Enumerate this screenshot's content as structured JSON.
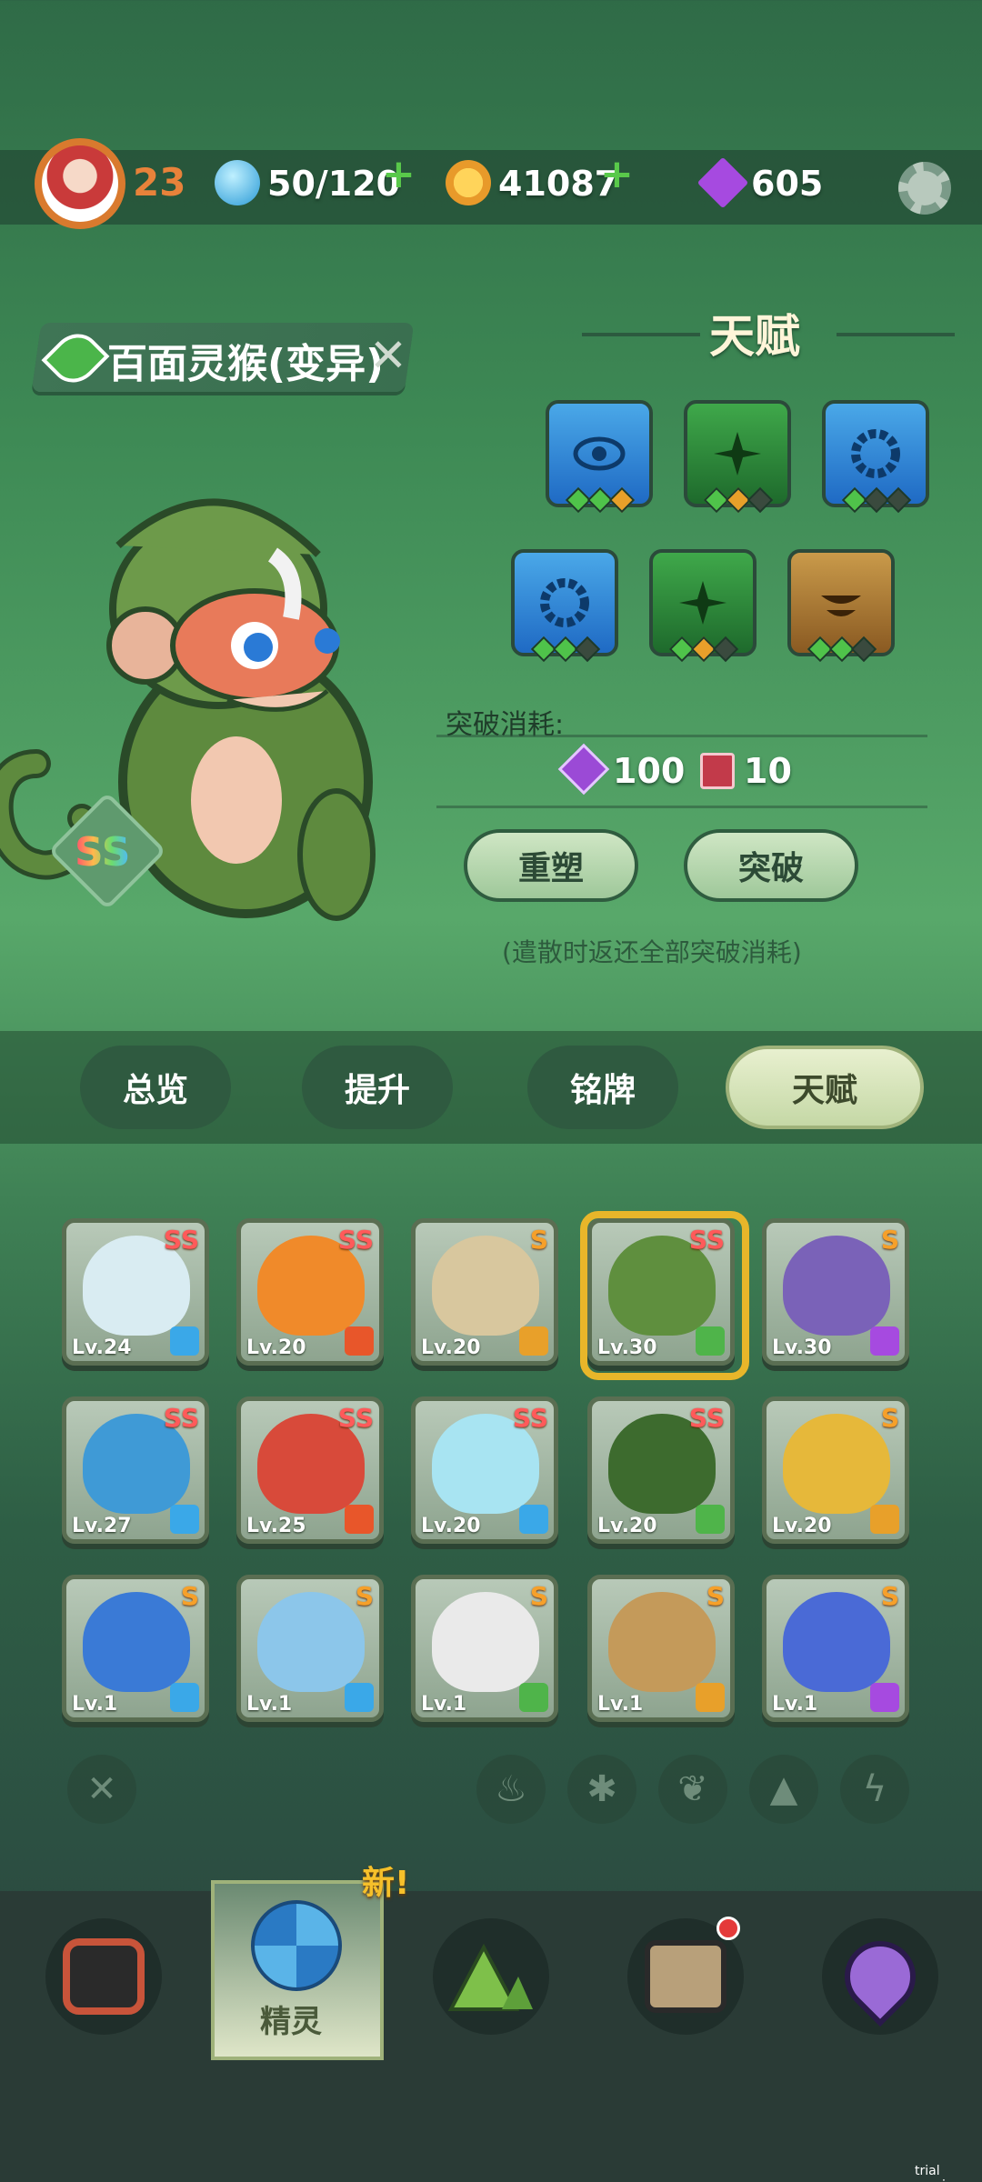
{
  "player": {
    "level": "23"
  },
  "resources": {
    "energy": "50/120",
    "coins": "41087",
    "gems": "605"
  },
  "pet": {
    "name": "百面灵猴(变异)",
    "rank": "SS"
  },
  "talent": {
    "title": "天赋",
    "cards_row1": [
      {
        "icon": "eye-icon",
        "color": "blue"
      },
      {
        "icon": "spike-icon",
        "color": "green"
      },
      {
        "icon": "gear-ring-icon",
        "color": "blue"
      }
    ],
    "cards_row2": [
      {
        "icon": "gear-ring-icon",
        "color": "blue"
      },
      {
        "icon": "spike-icon",
        "color": "green"
      },
      {
        "icon": "bowl-icon",
        "color": "gold"
      }
    ],
    "breakthrough_label": "突破消耗:",
    "cost_gems": "100",
    "cost_books": "10",
    "reset_button": "重塑",
    "breakthrough_button": "突破",
    "hint": "(遣散时返还全部突破消耗)"
  },
  "tabs": [
    {
      "label": "总览"
    },
    {
      "label": "提升"
    },
    {
      "label": "铭牌"
    },
    {
      "label": "天赋"
    }
  ],
  "pets": [
    {
      "rank": "SS",
      "level": "Lv.24",
      "element": "ice",
      "color": "#d9ecf2"
    },
    {
      "rank": "SS",
      "level": "Lv.20",
      "element": "fire",
      "color": "#f08a2a"
    },
    {
      "rank": "S",
      "level": "Lv.20",
      "element": "earth",
      "color": "#d8c79e"
    },
    {
      "rank": "SS",
      "level": "Lv.30",
      "element": "grass",
      "color": "#5f8f3e"
    },
    {
      "rank": "S",
      "level": "Lv.30",
      "element": "thunder",
      "color": "#7a62b8"
    },
    {
      "rank": "SS",
      "level": "Lv.27",
      "element": "ice",
      "color": "#3f9ad6"
    },
    {
      "rank": "SS",
      "level": "Lv.25",
      "element": "fire",
      "color": "#d84a3a"
    },
    {
      "rank": "SS",
      "level": "Lv.20",
      "element": "ice",
      "color": "#a8e4f2"
    },
    {
      "rank": "SS",
      "level": "Lv.20",
      "element": "grass",
      "color": "#3d6b2e"
    },
    {
      "rank": "S",
      "level": "Lv.20",
      "element": "earth",
      "color": "#e6b83a"
    },
    {
      "rank": "S",
      "level": "Lv.1",
      "element": "ice",
      "color": "#3a7ad6"
    },
    {
      "rank": "S",
      "level": "Lv.1",
      "element": "ice",
      "color": "#8cc6ea"
    },
    {
      "rank": "S",
      "level": "Lv.1",
      "element": "grass",
      "color": "#eaeaea"
    },
    {
      "rank": "S",
      "level": "Lv.1",
      "element": "earth",
      "color": "#c49a5a"
    },
    {
      "rank": "S",
      "level": "Lv.1",
      "element": "thunder",
      "color": "#4a6ad6"
    }
  ],
  "nav": {
    "active_label": "精灵",
    "new_badge": "新!"
  },
  "watermark": "trial version"
}
